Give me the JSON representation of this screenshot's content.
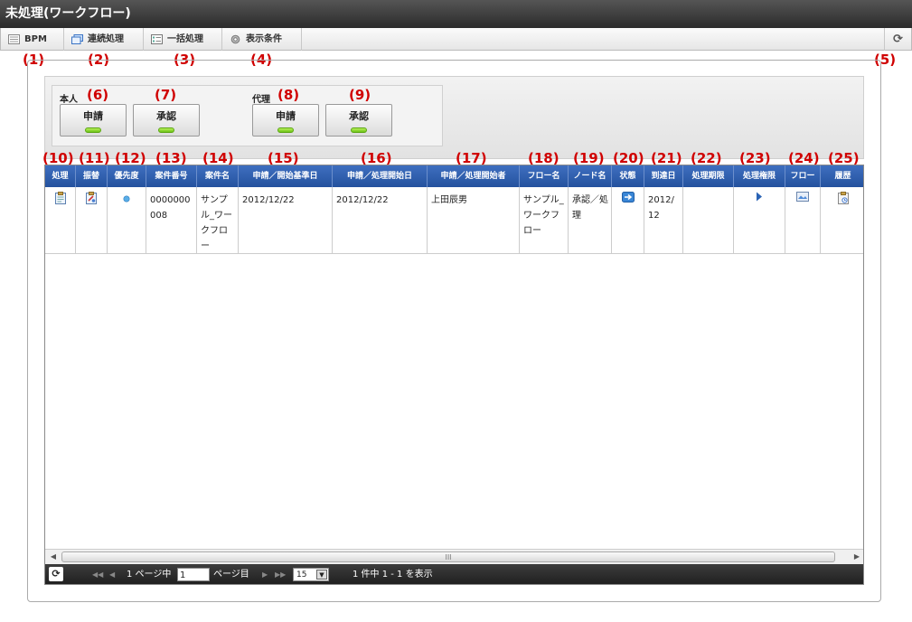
{
  "window": {
    "title": "未処理(ワークフロー)"
  },
  "toolbar": {
    "bpm_label": "BPM",
    "continuous_label": "連続処理",
    "batch_label": "一括処理",
    "display_label": "表示条件",
    "refresh_glyph": "⟳"
  },
  "callouts": [
    "(1)",
    "(2)",
    "(3)",
    "(4)",
    "(5)",
    "(6)",
    "(7)",
    "(8)",
    "(9)",
    "(10)",
    "(11)",
    "(12)",
    "(13)",
    "(14)",
    "(15)",
    "(16)",
    "(17)",
    "(18)",
    "(19)",
    "(20)",
    "(21)",
    "(22)",
    "(23)",
    "(24)",
    "(25)"
  ],
  "menu": {
    "self_label": "本人",
    "proxy_label": "代理",
    "self_apply": "申請",
    "self_approve": "承認",
    "proxy_apply": "申請",
    "proxy_approve": "承認",
    "led_color": "#7ed321"
  },
  "grid": {
    "header_color": "#2f5fae",
    "columns": [
      "処理",
      "振替",
      "優先度",
      "案件番号",
      "案件名",
      "申請／開始基準日",
      "申請／処理開始日",
      "申請／処理開始者",
      "フロー名",
      "ノード名",
      "状態",
      "到達日",
      "処理期限",
      "処理権限",
      "フロー",
      "履歴"
    ],
    "rows": [
      {
        "matter_no": "0000000008",
        "matter_name": "サンプル_ワークフロー",
        "base_date": "2012/12/22",
        "start_date": "2012/12/22",
        "starter": "上田辰男",
        "flow_name": "サンプル_ワークフロー",
        "node_name": "承認／処理",
        "arrival": "2012/12",
        "deadline": ""
      }
    ],
    "scroll_grip": "III"
  },
  "pager": {
    "refresh_glyph": "⟳",
    "first": "◀◀",
    "prev": "◀",
    "page_prefix": "1 ページ中",
    "page_value": "1",
    "page_suffix": "ページ目",
    "next": "▶",
    "last": "▶▶",
    "per_page": "15",
    "summary": "1 件中 1 - 1 を表示"
  }
}
